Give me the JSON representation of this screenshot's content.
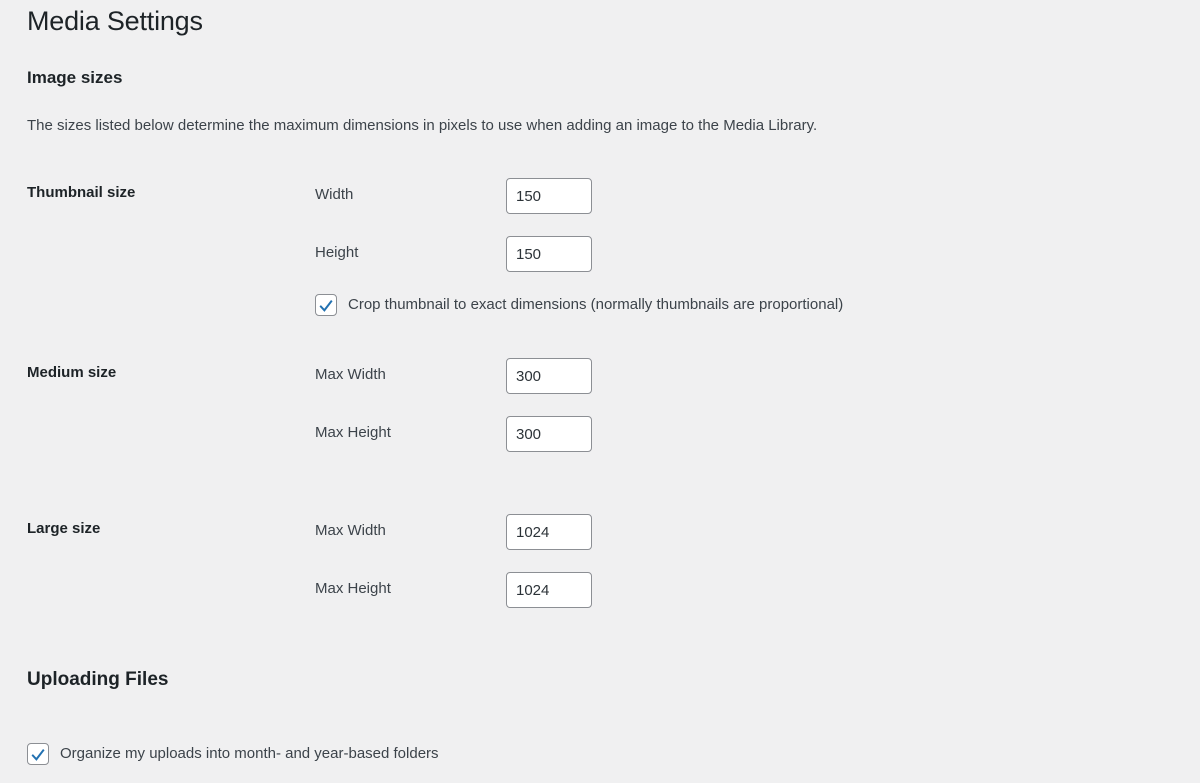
{
  "page": {
    "title": "Media Settings"
  },
  "image_sizes": {
    "heading": "Image sizes",
    "description": "The sizes listed below determine the maximum dimensions in pixels to use when adding an image to the Media Library.",
    "groups": [
      {
        "key": "thumbnail",
        "label": "Thumbnail size",
        "fields": [
          {
            "label": "Width",
            "value": "150"
          },
          {
            "label": "Height",
            "value": "150"
          }
        ]
      },
      {
        "key": "medium",
        "label": "Medium size",
        "fields": [
          {
            "label": "Max Width",
            "value": "300"
          },
          {
            "label": "Max Height",
            "value": "300"
          }
        ]
      },
      {
        "key": "large",
        "label": "Large size",
        "fields": [
          {
            "label": "Max Width",
            "value": "1024"
          },
          {
            "label": "Max Height",
            "value": "1024"
          }
        ]
      }
    ],
    "crop_thumbnail": {
      "label": "Crop thumbnail to exact dimensions (normally thumbnails are proportional)",
      "checked": true
    }
  },
  "uploading_files": {
    "heading": "Uploading Files",
    "organize_uploads": {
      "label": "Organize my uploads into month- and year-based folders",
      "checked": true
    }
  },
  "colors": {
    "background": "#f0f0f1",
    "text": "#3c434a",
    "heading": "#1d2327",
    "input_border": "#8c8f94",
    "input_background": "#ffffff",
    "checkbox_accent": "#2271b1"
  },
  "icons": {
    "checkmark": "checkmark-icon"
  }
}
